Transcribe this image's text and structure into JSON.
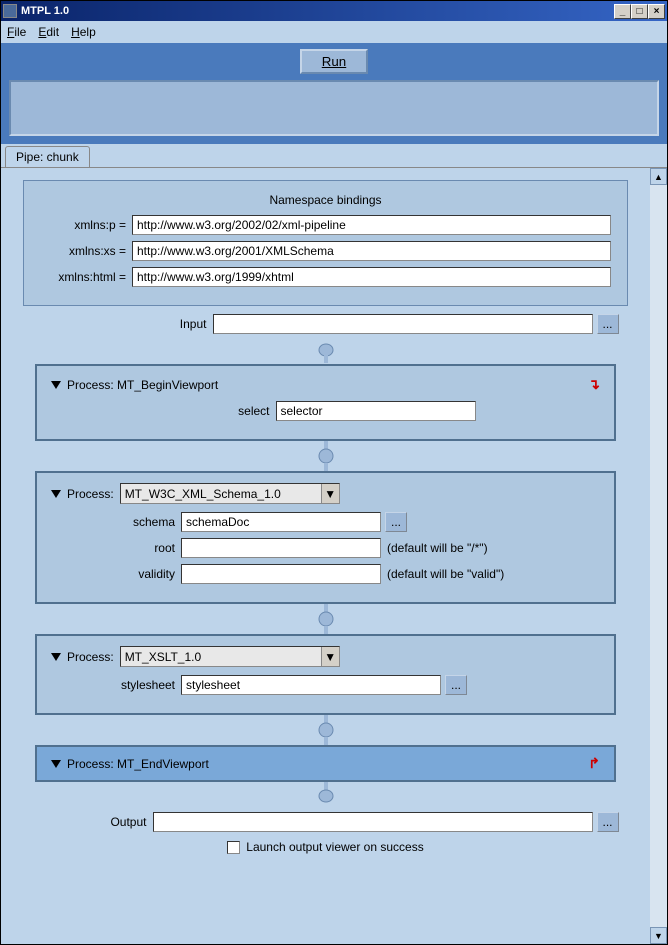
{
  "window": {
    "title": "MTPL 1.0"
  },
  "menu": {
    "file": "File",
    "edit": "Edit",
    "help": "Help"
  },
  "toolbar": {
    "run": "Run"
  },
  "tab": {
    "label": "Pipe: chunk"
  },
  "namespace": {
    "title": "Namespace bindings",
    "rows": [
      {
        "label": "xmlns:p =",
        "value": "http://www.w3.org/2002/02/xml-pipeline"
      },
      {
        "label": "xmlns:xs =",
        "value": "http://www.w3.org/2001/XMLSchema"
      },
      {
        "label": "xmlns:html =",
        "value": "http://www.w3.org/1999/xhtml"
      }
    ]
  },
  "input": {
    "label": "Input",
    "value": ""
  },
  "process1": {
    "header": "Process: MT_BeginViewport",
    "rows": [
      {
        "label": "select",
        "value": "selector"
      }
    ]
  },
  "process2": {
    "header": "Process:",
    "selected": "MT_W3C_XML_Schema_1.0",
    "rows": [
      {
        "label": "schema",
        "value": "schemaDoc",
        "browse": true
      },
      {
        "label": "root",
        "value": "",
        "hint": "(default will be \"/*\")"
      },
      {
        "label": "validity",
        "value": "",
        "hint": "(default will be \"valid\")"
      }
    ]
  },
  "process3": {
    "header": "Process:",
    "selected": "MT_XSLT_1.0",
    "rows": [
      {
        "label": "stylesheet",
        "value": "stylesheet",
        "browse": true
      }
    ]
  },
  "process4": {
    "header": "Process: MT_EndViewport"
  },
  "output": {
    "label": "Output",
    "value": ""
  },
  "launch": {
    "label": "Launch output viewer on success"
  }
}
